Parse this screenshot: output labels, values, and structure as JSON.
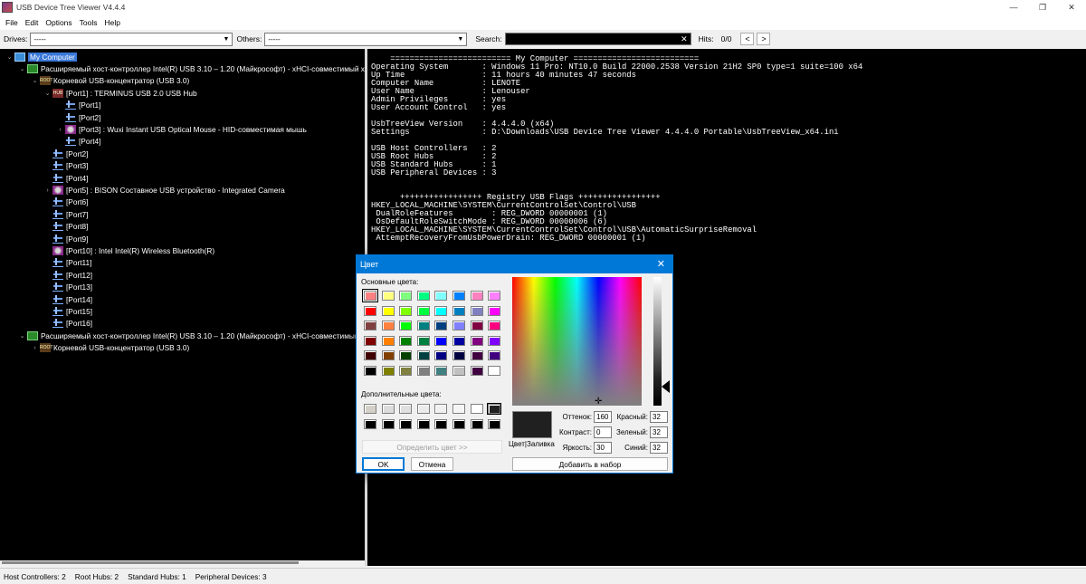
{
  "window": {
    "title": "USB Device Tree Viewer V4.4.4",
    "minimize": "—",
    "restore": "❐",
    "close": "✕"
  },
  "menu": [
    "File",
    "Edit",
    "Options",
    "Tools",
    "Help"
  ],
  "toolbar": {
    "drives_label": "Drives:",
    "drives_value": "-----",
    "others_label": "Others:",
    "others_value": "-----",
    "search_label": "Search:",
    "search_value": "",
    "hits_label": "Hits:",
    "hits_value": "0/0",
    "prev": "<",
    "next": ">"
  },
  "tree": [
    {
      "level": 0,
      "exp": "⌄",
      "icon": "computer",
      "label": "My Computer",
      "selected": true
    },
    {
      "level": 1,
      "exp": "⌄",
      "icon": "controller",
      "label": "Расширяемый хост-контроллер Intel(R) USB 3.10 – 1.20 (Майкрософт) - xHCI-совместимый хо"
    },
    {
      "level": 2,
      "exp": "⌄",
      "icon": "root",
      "label": "Корневой USB-концентратор (USB 3.0)"
    },
    {
      "level": 3,
      "exp": "⌄",
      "icon": "hub",
      "label": "[Port1] : TERMINUS USB 2.0 USB Hub"
    },
    {
      "level": 4,
      "exp": "",
      "icon": "port",
      "label": "[Port1]"
    },
    {
      "level": 4,
      "exp": "",
      "icon": "port",
      "label": "[Port2]"
    },
    {
      "level": 4,
      "exp": "›",
      "icon": "device",
      "label": "[Port3] : Wuxi Instant USB Optical Mouse - HID-совместимая мышь"
    },
    {
      "level": 4,
      "exp": "",
      "icon": "port",
      "label": "[Port4]"
    },
    {
      "level": 3,
      "exp": "",
      "icon": "port",
      "label": "[Port2]"
    },
    {
      "level": 3,
      "exp": "",
      "icon": "port",
      "label": "[Port3]"
    },
    {
      "level": 3,
      "exp": "",
      "icon": "port",
      "label": "[Port4]"
    },
    {
      "level": 3,
      "exp": "›",
      "icon": "device",
      "label": "[Port5] : BISON Составное USB устройство - Integrated Camera"
    },
    {
      "level": 3,
      "exp": "",
      "icon": "port",
      "label": "[Port6]"
    },
    {
      "level": 3,
      "exp": "",
      "icon": "port",
      "label": "[Port7]"
    },
    {
      "level": 3,
      "exp": "",
      "icon": "port",
      "label": "[Port8]"
    },
    {
      "level": 3,
      "exp": "",
      "icon": "port",
      "label": "[Port9]"
    },
    {
      "level": 3,
      "exp": "",
      "icon": "device",
      "label": "[Port10] : Intel Intel(R) Wireless Bluetooth(R)"
    },
    {
      "level": 3,
      "exp": "",
      "icon": "port",
      "label": "[Port11]"
    },
    {
      "level": 3,
      "exp": "",
      "icon": "port",
      "label": "[Port12]"
    },
    {
      "level": 3,
      "exp": "",
      "icon": "port",
      "label": "[Port13]"
    },
    {
      "level": 3,
      "exp": "",
      "icon": "port",
      "label": "[Port14]"
    },
    {
      "level": 3,
      "exp": "",
      "icon": "port",
      "label": "[Port15]"
    },
    {
      "level": 3,
      "exp": "",
      "icon": "port",
      "label": "[Port16]"
    },
    {
      "level": 1,
      "exp": "⌄",
      "icon": "controller",
      "label": "Расширяемый хост-контроллер Intel(R) USB 3.10 – 1.20 (Майкрософт) - xHCI-совместимый"
    },
    {
      "level": 2,
      "exp": "›",
      "icon": "root",
      "label": "Корневой USB-концентратор (USB 3.0)"
    }
  ],
  "info_text": "    ========================= My Computer ==========================\nOperating System       : Windows 11 Pro: NT10.0 Build 22000.2538 Version 21H2 SP0 type=1 suite=100 x64\nUp Time                : 11 hours 40 minutes 47 seconds\nComputer Name          : LENOTE\nUser Name              : Lenouser\nAdmin Privileges       : yes\nUser Account Control   : yes\n\nUsbTreeView Version    : 4.4.4.0 (x64)\nSettings               : D:\\Downloads\\USB Device Tree Viewer 4.4.4.0 Portable\\UsbTreeView_x64.ini\n\nUSB Host Controllers   : 2\nUSB Root Hubs          : 2\nUSB Standard Hubs      : 1\nUSB Peripheral Devices : 3\n\n\n      +++++++++++++++++ Registry USB Flags +++++++++++++++++\nHKEY_LOCAL_MACHINE\\SYSTEM\\CurrentControlSet\\Control\\USB\n DualRoleFeatures        : REG_DWORD 00000001 (1)\n OsDefaultRoleSwitchMode : REG_DWORD 00000006 (6)\nHKEY_LOCAL_MACHINE\\SYSTEM\\CurrentControlSet\\Control\\USB\\AutomaticSurpriseRemoval\n AttemptRecoveryFromUsbPowerDrain: REG_DWORD 00000001 (1)",
  "status": [
    "Host Controllers: 2",
    "Root Hubs: 2",
    "Standard Hubs: 1",
    "Peripheral Devices: 3"
  ],
  "dialog": {
    "title": "Цвет",
    "close": "✕",
    "basic_label": "Основные цвета:",
    "custom_label": "Дополнительные цвета:",
    "define_button": "Определить цвет >>",
    "ok": "OK",
    "cancel": "Отмена",
    "add_button": "Добавить в набор",
    "preview_label": "Цвет|Заливка",
    "hue_label": "Оттенок:",
    "hue": "160",
    "sat_label": "Контраст:",
    "sat": "0",
    "lum_label": "Яркость:",
    "lum": "30",
    "red_label": "Красный:",
    "red": "32",
    "green_label": "Зеленый:",
    "green": "32",
    "blue_label": "Синий:",
    "blue": "32",
    "basic_colors": [
      "#ff8080",
      "#ffff80",
      "#80ff80",
      "#00ff80",
      "#80ffff",
      "#0080ff",
      "#ff80c0",
      "#ff80ff",
      "#ff0000",
      "#ffff00",
      "#80ff00",
      "#00ff40",
      "#00ffff",
      "#0080c0",
      "#8080c0",
      "#ff00ff",
      "#804040",
      "#ff8040",
      "#00ff00",
      "#008080",
      "#004080",
      "#8080ff",
      "#800040",
      "#ff0080",
      "#800000",
      "#ff8000",
      "#008000",
      "#008040",
      "#0000ff",
      "#0000a0",
      "#800080",
      "#8000ff",
      "#400000",
      "#804000",
      "#004000",
      "#004040",
      "#000080",
      "#000040",
      "#400040",
      "#400080",
      "#000000",
      "#808000",
      "#808040",
      "#808080",
      "#408080",
      "#c0c0c0",
      "#400040",
      "#ffffff"
    ],
    "custom_colors": [
      "#d4d0c8",
      "#dcdcdc",
      "#e0e0e0",
      "#ebebeb",
      "#f0f0f0",
      "#f5f5f5",
      "#ffffff",
      "#202020",
      "#000000",
      "#000000",
      "#000000",
      "#000000",
      "#000000",
      "#000000",
      "#000000",
      "#000000"
    ]
  }
}
